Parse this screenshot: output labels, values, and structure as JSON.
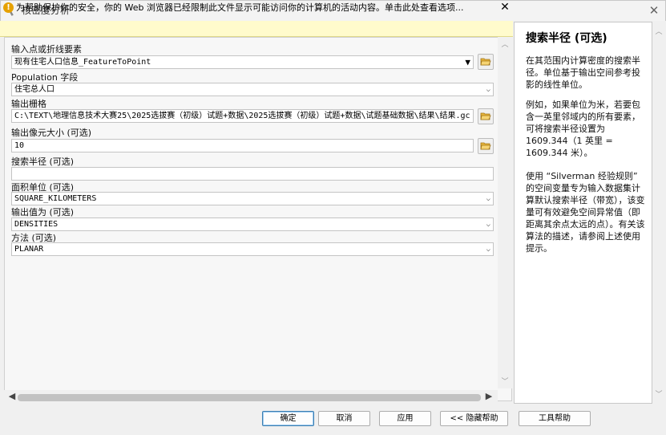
{
  "window": {
    "title": "核密度分析"
  },
  "infobar": {
    "text": "为帮助保护你的安全，你的 Web 浏览器已经限制此文件显示可能访问你的计算机的活动内容。单击此处查看选项..."
  },
  "form": {
    "input_features_label": "输入点或折线要素",
    "input_features_value": "现有住宅人口信息_FeatureToPoint",
    "population_field_label": "Population 字段",
    "population_field_value": "住宅总人口",
    "output_raster_label": "输出栅格",
    "output_raster_value": "C:\\TEXT\\地理信息技术大赛25\\2025选拔赛（初级）试题+数据\\2025选拔赛（初级）试题+数据\\试题基础数据\\结果\\结果.gc",
    "cell_size_label": "输出像元大小 (可选)",
    "cell_size_value": "10",
    "search_radius_label": "搜索半径 (可选)",
    "search_radius_value": "",
    "area_units_label": "面积单位 (可选)",
    "area_units_value": "SQUARE_KILOMETERS",
    "output_values_label": "输出值为 (可选)",
    "output_values_value": "DENSITIES",
    "method_label": "方法 (可选)",
    "method_value": "PLANAR"
  },
  "help": {
    "title": "搜索半径 (可选)",
    "p1": "在其范围内计算密度的搜索半径。单位基于输出空间参考投影的线性单位。",
    "p2": "例如，如果单位为米，若要包含一英里邻域内的所有要素，可将搜索半径设置为 1609.344（1 英里 = 1609.344 米）。",
    "p3": "使用 “Silverman 经验规则” 的空间变量专为输入数据集计算默认搜索半径（带宽），该变量可有效避免空间异常值（即距离其余点太远的点）。有关该算法的描述，请参阅上述使用提示。"
  },
  "buttons": {
    "ok": "确定",
    "cancel": "取消",
    "apply": "应用",
    "hide_help": "<< 隐藏帮助",
    "tool_help": "工具帮助"
  },
  "icons": {
    "app": "hammer-icon",
    "info": "shield-warning-icon",
    "folder": "open-folder-icon"
  },
  "colors": {
    "infobar_bg": "#fffbcc",
    "folder_yellow": "#e8b53a",
    "default_button_border": "#3c7fb1"
  }
}
